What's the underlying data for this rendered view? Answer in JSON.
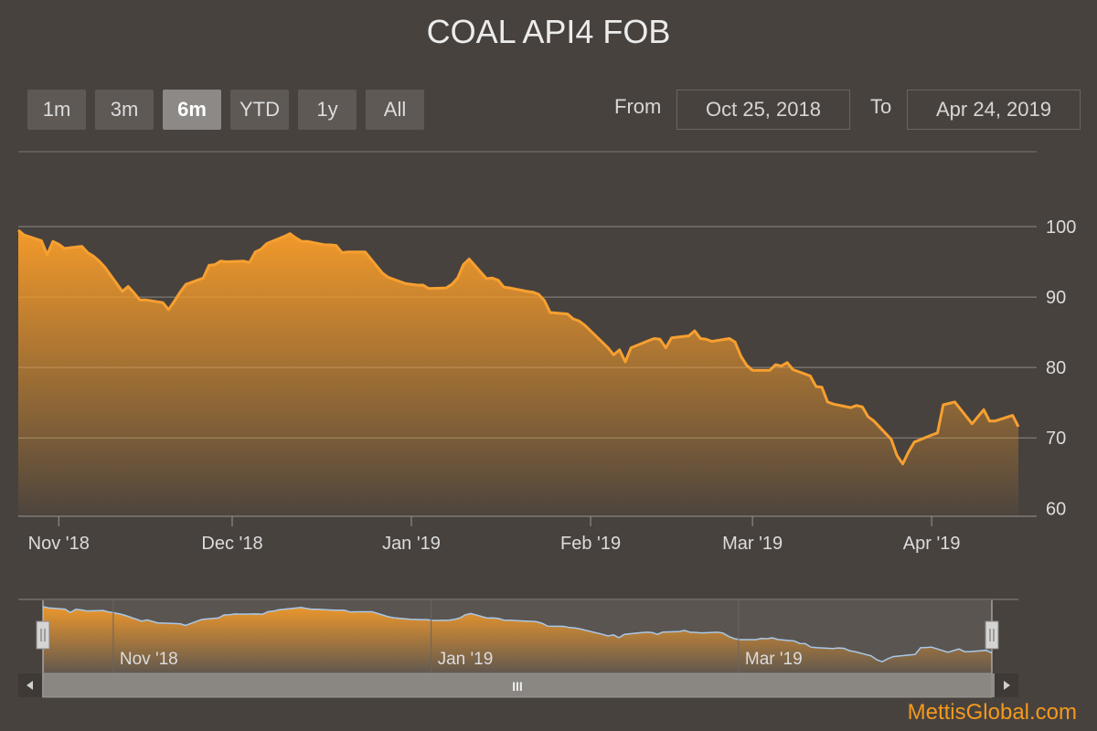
{
  "title": "COAL API4 FOB",
  "range_selector": {
    "buttons": [
      "1m",
      "3m",
      "6m",
      "YTD",
      "1y",
      "All"
    ],
    "active": "6m",
    "from_label": "From",
    "from_value": "Oct 25, 2018",
    "to_label": "To",
    "to_value": "Apr 24, 2019"
  },
  "navigator": {
    "x_labels": [
      "Nov '18",
      "Jan '19",
      "Mar '19"
    ],
    "scrollbar_grip": "III"
  },
  "branding": "MettisGlobal.com",
  "colors": {
    "background": "#48423e",
    "line": "#f7a030",
    "navigator_line": "#a9c8e8",
    "brand": "#f39a1c"
  },
  "chart_data": {
    "type": "area",
    "title": "COAL API4 FOB",
    "y_ticks": [
      60,
      70,
      80,
      90,
      100
    ],
    "ylim": [
      59,
      100
    ],
    "x_ticks": [
      "Nov '18",
      "Dec '18",
      "Jan '19",
      "Feb '19",
      "Mar '19",
      "Apr '19"
    ],
    "x_tick_dates": [
      "2018-11-01",
      "2018-12-01",
      "2019-01-01",
      "2019-02-01",
      "2019-03-01",
      "2019-04-01"
    ],
    "y_axis_position": "right",
    "grid": true,
    "series": [
      {
        "values": [
          [
            "2018-10-25",
            99.5
          ],
          [
            "2018-10-26",
            98.8
          ],
          [
            "2018-10-29",
            98.0
          ],
          [
            "2018-10-30",
            96.0
          ],
          [
            "2018-10-31",
            97.9
          ],
          [
            "2018-11-01",
            97.5
          ],
          [
            "2018-11-02",
            96.9
          ],
          [
            "2018-11-05",
            97.2
          ],
          [
            "2018-11-06",
            96.3
          ],
          [
            "2018-11-07",
            95.8
          ],
          [
            "2018-11-08",
            95.1
          ],
          [
            "2018-11-09",
            94.2
          ],
          [
            "2018-11-12",
            90.8
          ],
          [
            "2018-11-13",
            91.5
          ],
          [
            "2018-11-14",
            90.6
          ],
          [
            "2018-11-15",
            89.6
          ],
          [
            "2018-11-16",
            89.6
          ],
          [
            "2018-11-19",
            89.2
          ],
          [
            "2018-11-20",
            88.2
          ],
          [
            "2018-11-21",
            89.4
          ],
          [
            "2018-11-22",
            90.7
          ],
          [
            "2018-11-23",
            91.8
          ],
          [
            "2018-11-26",
            92.7
          ],
          [
            "2018-11-27",
            94.5
          ],
          [
            "2018-11-28",
            94.6
          ],
          [
            "2018-11-29",
            95.1
          ],
          [
            "2018-11-30",
            95.0
          ],
          [
            "2018-12-03",
            95.1
          ],
          [
            "2018-12-04",
            94.9
          ],
          [
            "2018-12-05",
            96.4
          ],
          [
            "2018-12-06",
            96.8
          ],
          [
            "2018-12-07",
            97.6
          ],
          [
            "2018-12-10",
            98.6
          ],
          [
            "2018-12-11",
            99.0
          ],
          [
            "2018-12-12",
            98.4
          ],
          [
            "2018-12-13",
            97.9
          ],
          [
            "2018-12-14",
            97.9
          ],
          [
            "2018-12-17",
            97.4
          ],
          [
            "2018-12-18",
            97.4
          ],
          [
            "2018-12-19",
            97.3
          ],
          [
            "2018-12-20",
            96.3
          ],
          [
            "2018-12-21",
            96.4
          ],
          [
            "2018-12-24",
            96.4
          ],
          [
            "2018-12-27",
            93.4
          ],
          [
            "2018-12-28",
            92.8
          ],
          [
            "2018-12-31",
            91.9
          ],
          [
            "2019-01-02",
            91.7
          ],
          [
            "2019-01-03",
            91.7
          ],
          [
            "2019-01-04",
            91.2
          ],
          [
            "2019-01-07",
            91.3
          ],
          [
            "2019-01-08",
            91.8
          ],
          [
            "2019-01-09",
            92.7
          ],
          [
            "2019-01-10",
            94.6
          ],
          [
            "2019-01-11",
            95.4
          ],
          [
            "2019-01-14",
            92.6
          ],
          [
            "2019-01-15",
            92.7
          ],
          [
            "2019-01-16",
            92.4
          ],
          [
            "2019-01-17",
            91.4
          ],
          [
            "2019-01-18",
            91.3
          ],
          [
            "2019-01-21",
            90.8
          ],
          [
            "2019-01-22",
            90.7
          ],
          [
            "2019-01-23",
            90.4
          ],
          [
            "2019-01-24",
            89.5
          ],
          [
            "2019-01-25",
            87.8
          ],
          [
            "2019-01-28",
            87.6
          ],
          [
            "2019-01-29",
            86.9
          ],
          [
            "2019-01-30",
            86.6
          ],
          [
            "2019-01-31",
            86.0
          ],
          [
            "2019-02-01",
            85.2
          ],
          [
            "2019-02-04",
            82.8
          ],
          [
            "2019-02-05",
            81.8
          ],
          [
            "2019-02-06",
            82.5
          ],
          [
            "2019-02-07",
            80.8
          ],
          [
            "2019-02-08",
            82.8
          ],
          [
            "2019-02-11",
            83.8
          ],
          [
            "2019-02-12",
            84.1
          ],
          [
            "2019-02-13",
            84.0
          ],
          [
            "2019-02-14",
            82.8
          ],
          [
            "2019-02-15",
            84.2
          ],
          [
            "2019-02-18",
            84.5
          ],
          [
            "2019-02-19",
            85.2
          ],
          [
            "2019-02-20",
            84.1
          ],
          [
            "2019-02-21",
            84.0
          ],
          [
            "2019-02-22",
            83.7
          ],
          [
            "2019-02-25",
            84.1
          ],
          [
            "2019-02-26",
            83.6
          ],
          [
            "2019-02-27",
            81.6
          ],
          [
            "2019-02-28",
            80.3
          ],
          [
            "2019-03-01",
            79.6
          ],
          [
            "2019-03-04",
            79.6
          ],
          [
            "2019-03-05",
            80.4
          ],
          [
            "2019-03-06",
            80.2
          ],
          [
            "2019-03-07",
            80.7
          ],
          [
            "2019-03-08",
            79.7
          ],
          [
            "2019-03-11",
            78.8
          ],
          [
            "2019-03-12",
            77.3
          ],
          [
            "2019-03-13",
            77.2
          ],
          [
            "2019-03-14",
            75.1
          ],
          [
            "2019-03-15",
            74.8
          ],
          [
            "2019-03-18",
            74.3
          ],
          [
            "2019-03-19",
            74.6
          ],
          [
            "2019-03-20",
            74.4
          ],
          [
            "2019-03-21",
            73.0
          ],
          [
            "2019-03-22",
            72.4
          ],
          [
            "2019-03-25",
            69.8
          ],
          [
            "2019-03-26",
            67.5
          ],
          [
            "2019-03-27",
            66.3
          ],
          [
            "2019-03-28",
            68.0
          ],
          [
            "2019-03-29",
            69.4
          ],
          [
            "2019-04-01",
            70.4
          ],
          [
            "2019-04-02",
            70.7
          ],
          [
            "2019-04-03",
            74.7
          ],
          [
            "2019-04-04",
            74.9
          ],
          [
            "2019-04-05",
            75.1
          ],
          [
            "2019-04-08",
            72.0
          ],
          [
            "2019-04-09",
            73.0
          ],
          [
            "2019-04-10",
            74.0
          ],
          [
            "2019-04-11",
            72.4
          ],
          [
            "2019-04-12",
            72.4
          ],
          [
            "2019-04-15",
            73.2
          ],
          [
            "2019-04-16",
            71.6
          ]
        ]
      }
    ]
  }
}
